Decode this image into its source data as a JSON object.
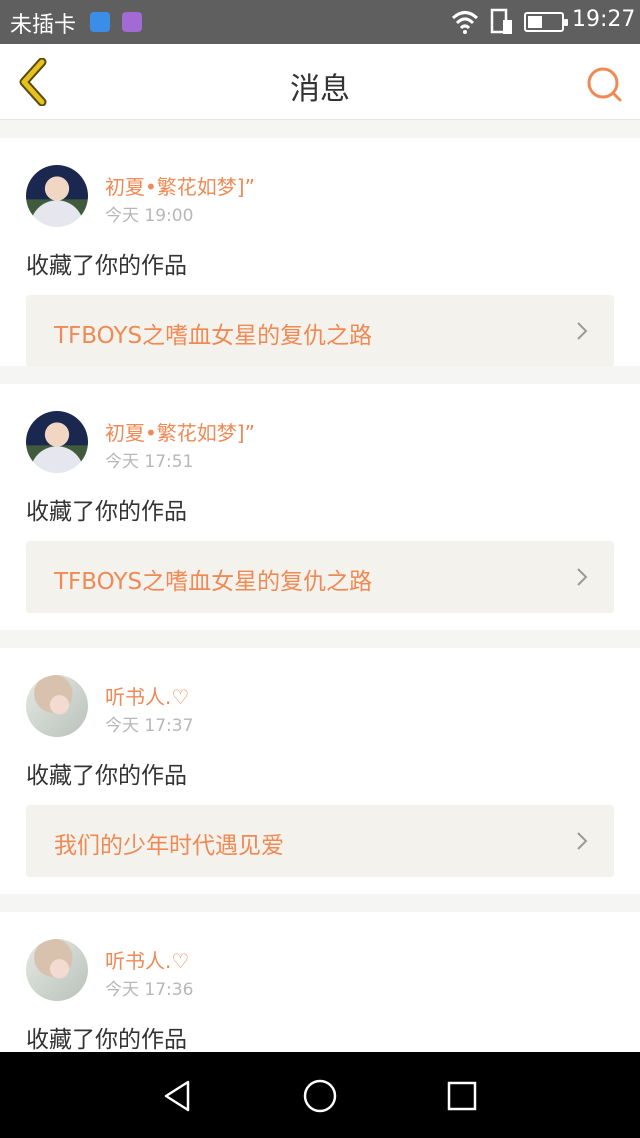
{
  "status_bar": {
    "carrier": "未插卡",
    "time": "19:27",
    "battery_level": 0.45,
    "icons": [
      "wifi-hotspot-icon",
      "gallery-icon",
      "wifi-icon",
      "sim-icon",
      "battery-icon"
    ]
  },
  "header": {
    "title": "消息",
    "back_icon": "chevron-left-icon",
    "search_icon": "search-icon"
  },
  "colors": {
    "accent": "#ef8a55",
    "back_arrow": "#e6c21e",
    "card_bg": "#ffffff",
    "page_bg": "#f5f5f3",
    "work_bg": "#f4f2ec"
  },
  "messages": [
    {
      "user": "初夏•繁花如梦]”",
      "time": "今天 19:00",
      "action": "收藏了你的作品",
      "work": "TFBOYS之嗜血女星的复仇之路",
      "avatar": "avatar-boy"
    },
    {
      "user": "初夏•繁花如梦]”",
      "time": "今天 17:51",
      "action": "收藏了你的作品",
      "work": "TFBOYS之嗜血女星的复仇之路",
      "avatar": "avatar-boy"
    },
    {
      "user": "听书人.♡",
      "time": "今天 17:37",
      "action": "收藏了你的作品",
      "work": "我们的少年时代遇见爱",
      "avatar": "avatar-girl"
    },
    {
      "user": "听书人.♡",
      "time": "今天 17:36",
      "action": "收藏了你的作品",
      "work": "",
      "avatar": "avatar-girl"
    }
  ],
  "system_nav": {
    "back_icon": "triangle-back-icon",
    "home_icon": "circle-home-icon",
    "recent_icon": "square-recent-icon"
  }
}
